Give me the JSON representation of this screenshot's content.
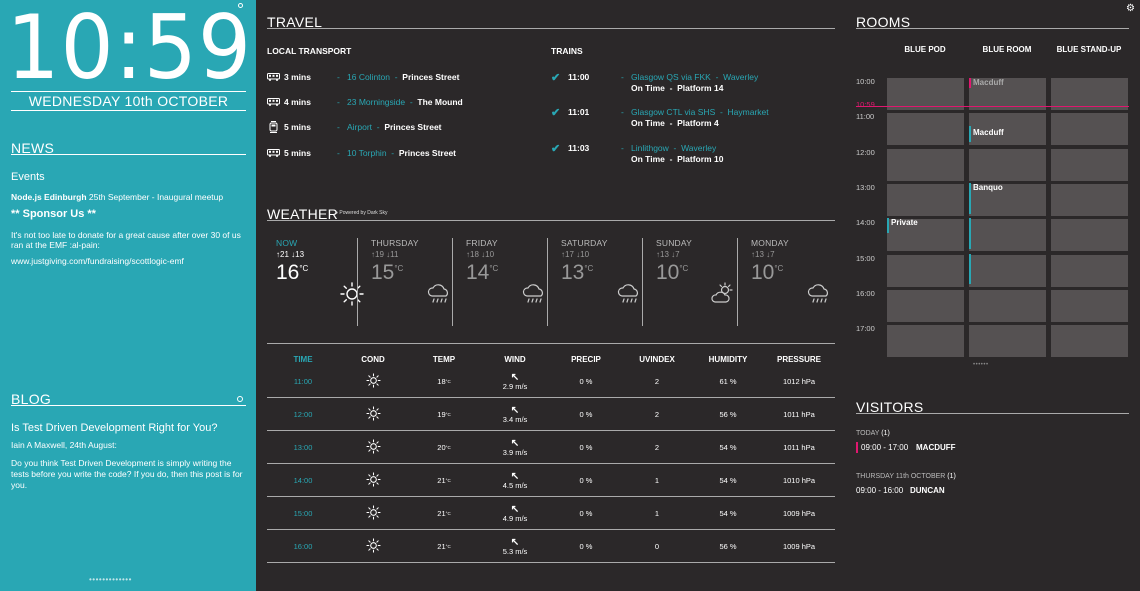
{
  "clock": {
    "time": "10:59",
    "date": "WEDNESDAY 10th OCTOBER"
  },
  "news": {
    "heading": "NEWS",
    "events_label": "Events",
    "event1_title": "Node.js Edinburgh",
    "event1_text": " 25th September - Inaugural meetup",
    "sponsor": "** Sponsor Us **",
    "body": "It's not too late to donate for a great cause after over 30 of us ran at the EMF :al-pain:",
    "link": "www.justgiving.com/fundraising/scottlogic-emf"
  },
  "blog": {
    "heading": "BLOG",
    "title": "Is Test Driven Development Right for You?",
    "meta": "Iain A Maxwell, 24th August:",
    "body": "Do you think Test Driven Development is simply writing the tests before you write the code? If you do, then this post is for you.",
    "pager": "•••••••••••••"
  },
  "travel": {
    "heading": "TRAVEL",
    "local_label": "LOCAL TRANSPORT",
    "trains_label": "TRAINS",
    "buses": [
      {
        "mins": "3 mins",
        "route": "16 Colinton",
        "dest": "Princes Street",
        "icon": "bus-icon"
      },
      {
        "mins": "4 mins",
        "route": "23 Morningside",
        "dest": "The Mound",
        "icon": "bus-icon"
      },
      {
        "mins": "5 mins",
        "route": "Airport",
        "dest": "Princes Street",
        "icon": "tram-icon"
      },
      {
        "mins": "5 mins",
        "route": "10 Torphin",
        "dest": "Princes Street",
        "icon": "bus-icon"
      }
    ],
    "trains": [
      {
        "time": "11:00",
        "route": "Glasgow QS via FKK",
        "dest": "Waverley",
        "status": "On Time",
        "platform": "Platform 14"
      },
      {
        "time": "11:01",
        "route": "Glasgow CTL via SHS",
        "dest": "Haymarket",
        "status": "On Time",
        "platform": "Platform 4"
      },
      {
        "time": "11:03",
        "route": "Linlithgow",
        "dest": "Waverley",
        "status": "On Time",
        "platform": "Platform 10"
      }
    ]
  },
  "weather": {
    "heading": "WEATHER",
    "powered": "Powered by Dark Sky",
    "days": [
      {
        "name": "NOW",
        "hilo": "↑21 ↓13",
        "temp": "16",
        "icon": "sun-icon"
      },
      {
        "name": "THURSDAY",
        "hilo": "↑19 ↓11",
        "temp": "15",
        "icon": "rain-cloud-icon"
      },
      {
        "name": "FRIDAY",
        "hilo": "↑18 ↓10",
        "temp": "14",
        "icon": "rain-cloud-icon"
      },
      {
        "name": "SATURDAY",
        "hilo": "↑17 ↓10",
        "temp": "13",
        "icon": "rain-cloud-icon"
      },
      {
        "name": "SUNDAY",
        "hilo": "↑13 ↓7",
        "temp": "10",
        "icon": "partly-cloudy-icon"
      },
      {
        "name": "MONDAY",
        "hilo": "↑13 ↓7",
        "temp": "10",
        "icon": "rain-cloud-icon"
      }
    ],
    "unit": "°C",
    "headers": [
      "TIME",
      "COND",
      "TEMP",
      "WIND",
      "PRECIP",
      "UVINDEX",
      "HUMIDITY",
      "PRESSURE"
    ],
    "hourly": [
      {
        "time": "11:00",
        "temp": "18",
        "wind": "2.9 m/s",
        "precip": "0 %",
        "uv": "2",
        "humidity": "61 %",
        "pressure": "1012 hPa"
      },
      {
        "time": "12:00",
        "temp": "19",
        "wind": "3.4 m/s",
        "precip": "0 %",
        "uv": "2",
        "humidity": "56 %",
        "pressure": "1011 hPa"
      },
      {
        "time": "13:00",
        "temp": "20",
        "wind": "3.9 m/s",
        "precip": "0 %",
        "uv": "2",
        "humidity": "54 %",
        "pressure": "1011 hPa"
      },
      {
        "time": "14:00",
        "temp": "21",
        "wind": "4.5 m/s",
        "precip": "0 %",
        "uv": "1",
        "humidity": "54 %",
        "pressure": "1010 hPa"
      },
      {
        "time": "15:00",
        "temp": "21",
        "wind": "4.9 m/s",
        "precip": "0 %",
        "uv": "1",
        "humidity": "54 %",
        "pressure": "1009 hPa"
      },
      {
        "time": "16:00",
        "temp": "21",
        "wind": "5.3 m/s",
        "precip": "0 %",
        "uv": "0",
        "humidity": "56 %",
        "pressure": "1009 hPa"
      }
    ],
    "temp_unit": "°C"
  },
  "rooms": {
    "heading": "ROOMS",
    "names": [
      "BLUE POD",
      "BLUE ROOM",
      "BLUE STAND-UP"
    ],
    "hours": [
      "10:00",
      "11:00",
      "12:00",
      "13:00",
      "14:00",
      "15:00",
      "16:00",
      "17:00"
    ],
    "now": "10:59",
    "bookings": [
      {
        "label": "Macduff"
      },
      {
        "label": "Macduff"
      },
      {
        "label": "Banquo"
      },
      {
        "label": "Private"
      }
    ],
    "pager": "••••••",
    "colors": {
      "teal": "#29a7b4",
      "pink": "#e0176f"
    }
  },
  "visitors": {
    "heading": "VISITORS",
    "today_label": "TODAY",
    "today_count": "(1)",
    "today_time": "09:00 - 17:00",
    "today_name": "MACDUFF",
    "next_label": "THURSDAY 11th OCTOBER",
    "next_count": "(1)",
    "next_time": "09:00 - 16:00",
    "next_name": "DUNCAN"
  }
}
